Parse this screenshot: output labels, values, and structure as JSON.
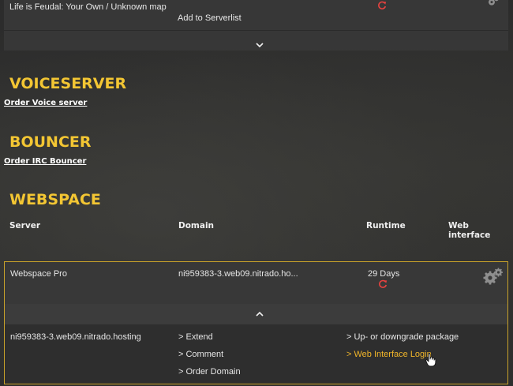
{
  "gameserver": {
    "name": "Life is Feudal: Your Own / Unknown map",
    "add_to_serverlist": "Add to Serverlist"
  },
  "voiceserver": {
    "title": "VOICESERVER",
    "order_link": "Order Voice server"
  },
  "bouncer": {
    "title": "BOUNCER",
    "order_link": "Order IRC Bouncer"
  },
  "webspace": {
    "title": "WEBSPACE",
    "columns": {
      "server": "Server",
      "domain": "Domain",
      "runtime": "Runtime",
      "web_interface": "Web interface"
    },
    "row": {
      "server": "Webspace Pro",
      "domain": "ni959383-3.web09.nitrado.ho...",
      "runtime": "29 Days"
    },
    "details": {
      "host": "ni959383-3.web09.nitrado.hosting",
      "actions_left": [
        "> Extend",
        "> Comment",
        "> Order Domain"
      ],
      "actions_right": [
        "> Up- or downgrade package",
        "> Web Interface Login"
      ]
    }
  },
  "colors": {
    "accent": "#f3c633",
    "highlight": "#f0b52a",
    "refresh": "#e8423f"
  }
}
